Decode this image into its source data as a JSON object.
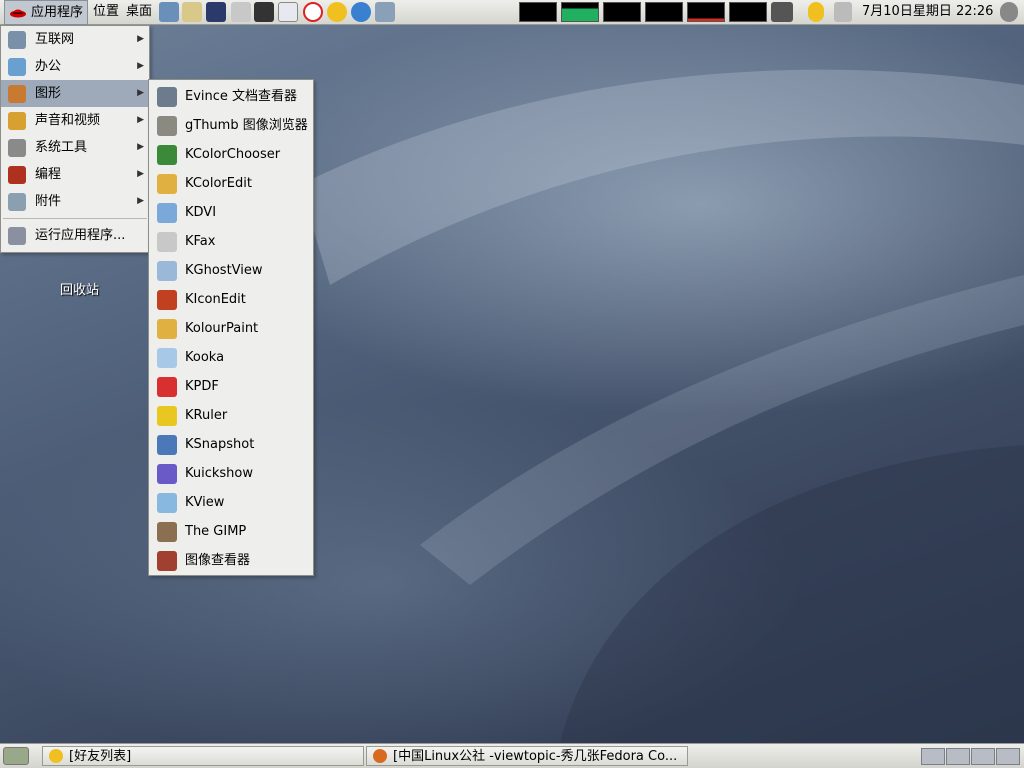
{
  "top_panel": {
    "applications": "应用程序",
    "places": "位置",
    "desktop": "桌面",
    "clock": "7月10日星期日  22:26",
    "launcher_icons": [
      "browser-icon",
      "mail-icon",
      "terminal-icon",
      "screenshot-icon",
      "camera-icon",
      "player-icon",
      "opera-icon",
      "messenger-icon",
      "qq-icon",
      "tool-icon"
    ],
    "monitor_count": 6
  },
  "apps_menu": {
    "items": [
      {
        "label": "互联网",
        "icon": "globe-icon",
        "submenu": true
      },
      {
        "label": "办公",
        "icon": "office-icon",
        "submenu": true
      },
      {
        "label": "图形",
        "icon": "graphics-icon",
        "submenu": true,
        "selected": true
      },
      {
        "label": "声音和视频",
        "icon": "media-icon",
        "submenu": true
      },
      {
        "label": "系统工具",
        "icon": "tools-icon",
        "submenu": true
      },
      {
        "label": "编程",
        "icon": "programming-icon",
        "submenu": true
      },
      {
        "label": "附件",
        "icon": "accessories-icon",
        "submenu": true
      }
    ],
    "run": "运行应用程序..."
  },
  "graphics_menu": {
    "items": [
      {
        "label": "Evince 文档查看器",
        "icon": "evince-icon",
        "color": "#6d7c8c"
      },
      {
        "label": "gThumb 图像浏览器",
        "icon": "gthumb-icon",
        "color": "#8a8a80"
      },
      {
        "label": "KColorChooser",
        "icon": "eyedropper-icon",
        "color": "#3a8a3a"
      },
      {
        "label": "KColorEdit",
        "icon": "palette-icon",
        "color": "#e0b040"
      },
      {
        "label": "KDVI",
        "icon": "magnifier-icon",
        "color": "#7aa8d8"
      },
      {
        "label": "KFax",
        "icon": "fax-icon",
        "color": "#c8c8c8"
      },
      {
        "label": "KGhostView",
        "icon": "ghostview-icon",
        "color": "#9ab8d8"
      },
      {
        "label": "KIconEdit",
        "icon": "iconedit-icon",
        "color": "#c04020"
      },
      {
        "label": "KolourPaint",
        "icon": "paint-icon",
        "color": "#e0b040"
      },
      {
        "label": "Kooka",
        "icon": "scanner-icon",
        "color": "#a8c8e8"
      },
      {
        "label": "KPDF",
        "icon": "pdf-icon",
        "color": "#d83030"
      },
      {
        "label": "KRuler",
        "icon": "ruler-icon",
        "color": "#e8c820"
      },
      {
        "label": "KSnapshot",
        "icon": "snapshot-icon",
        "color": "#4a78b8"
      },
      {
        "label": "Kuickshow",
        "icon": "kuickshow-icon",
        "color": "#6a5ac8"
      },
      {
        "label": "KView",
        "icon": "kview-icon",
        "color": "#88b8e0"
      },
      {
        "label": "The GIMP",
        "icon": "gimp-icon",
        "color": "#8a7050"
      },
      {
        "label": "图像查看器",
        "icon": "image-viewer-icon",
        "color": "#a04030"
      }
    ]
  },
  "desktop": {
    "trash": "回收站"
  },
  "bottom_panel": {
    "tasks": [
      {
        "label": "[好友列表]",
        "icon": "buddy-icon"
      },
      {
        "label": "[中国Linux公社  -viewtopic-秀几张Fedora Co...",
        "icon": "firefox-icon"
      }
    ],
    "workspaces": 4
  }
}
